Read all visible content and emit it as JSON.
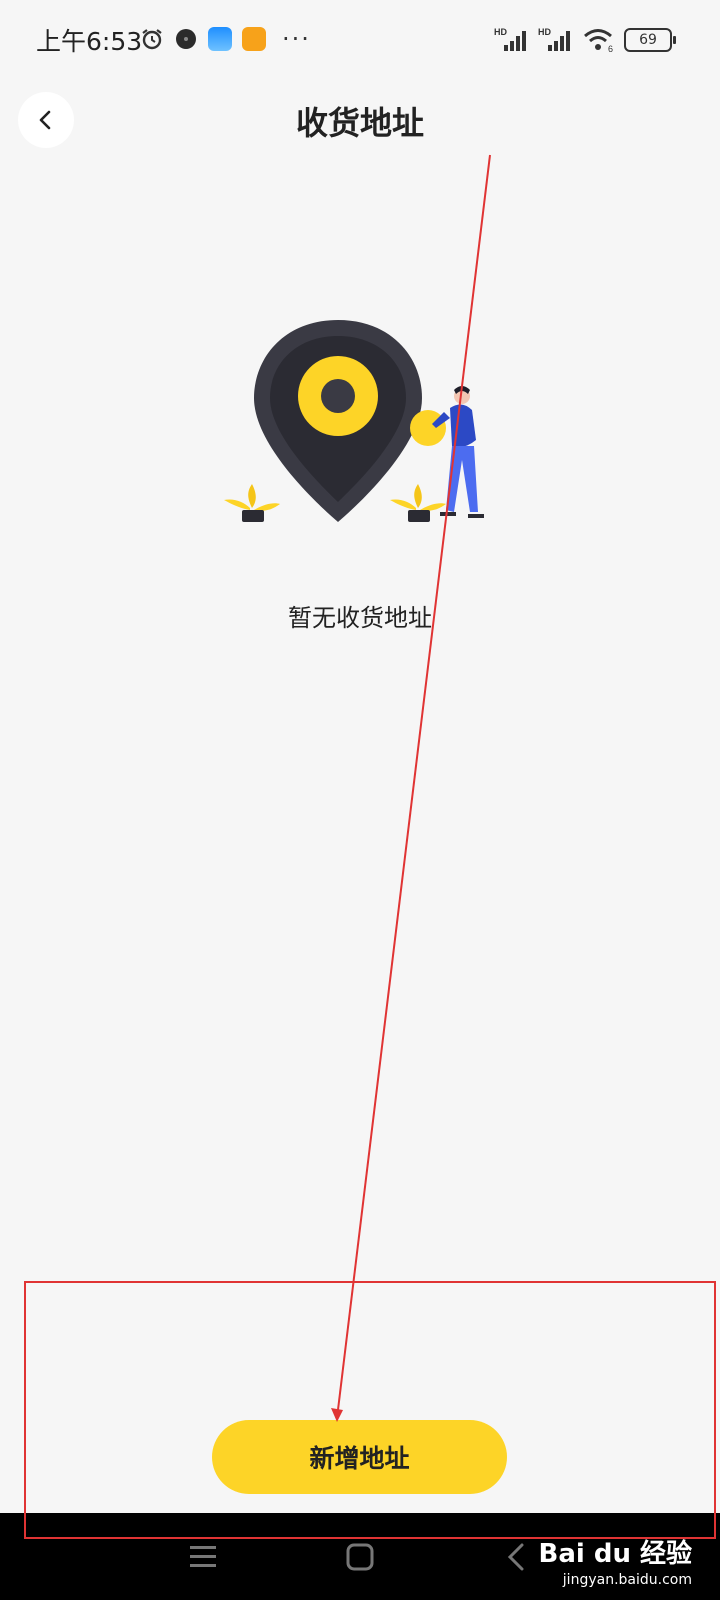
{
  "status_bar": {
    "time": "上午6:53",
    "left_icons": [
      "alarm-icon",
      "app-dark-dot-icon",
      "cloud-app-icon",
      "notes-app-icon"
    ],
    "more": "···",
    "signal_label_1": "HD",
    "signal_label_2": "HD",
    "wifi_sub": "6",
    "battery": "69"
  },
  "header": {
    "title": "收货地址",
    "back_icon": "chevron-left-icon"
  },
  "empty_state": {
    "text": "暂无收货地址",
    "illustration": "location-pin-with-person-illustration"
  },
  "actions": {
    "add_address_label": "新增地址"
  },
  "colors": {
    "accent": "#fdd427",
    "background": "#f6f6f6",
    "pin_dark": "#3a3a44",
    "person_blue": "#3b5bd9",
    "annotation_red": "#e03434"
  },
  "nav_bar": {
    "menu_icon": "menu-icon",
    "home_icon": "home-square-icon",
    "back_icon": "back-triangle-icon"
  },
  "watermark": {
    "brand": "Bai du 经验",
    "url": "jingyan.baidu.com"
  }
}
